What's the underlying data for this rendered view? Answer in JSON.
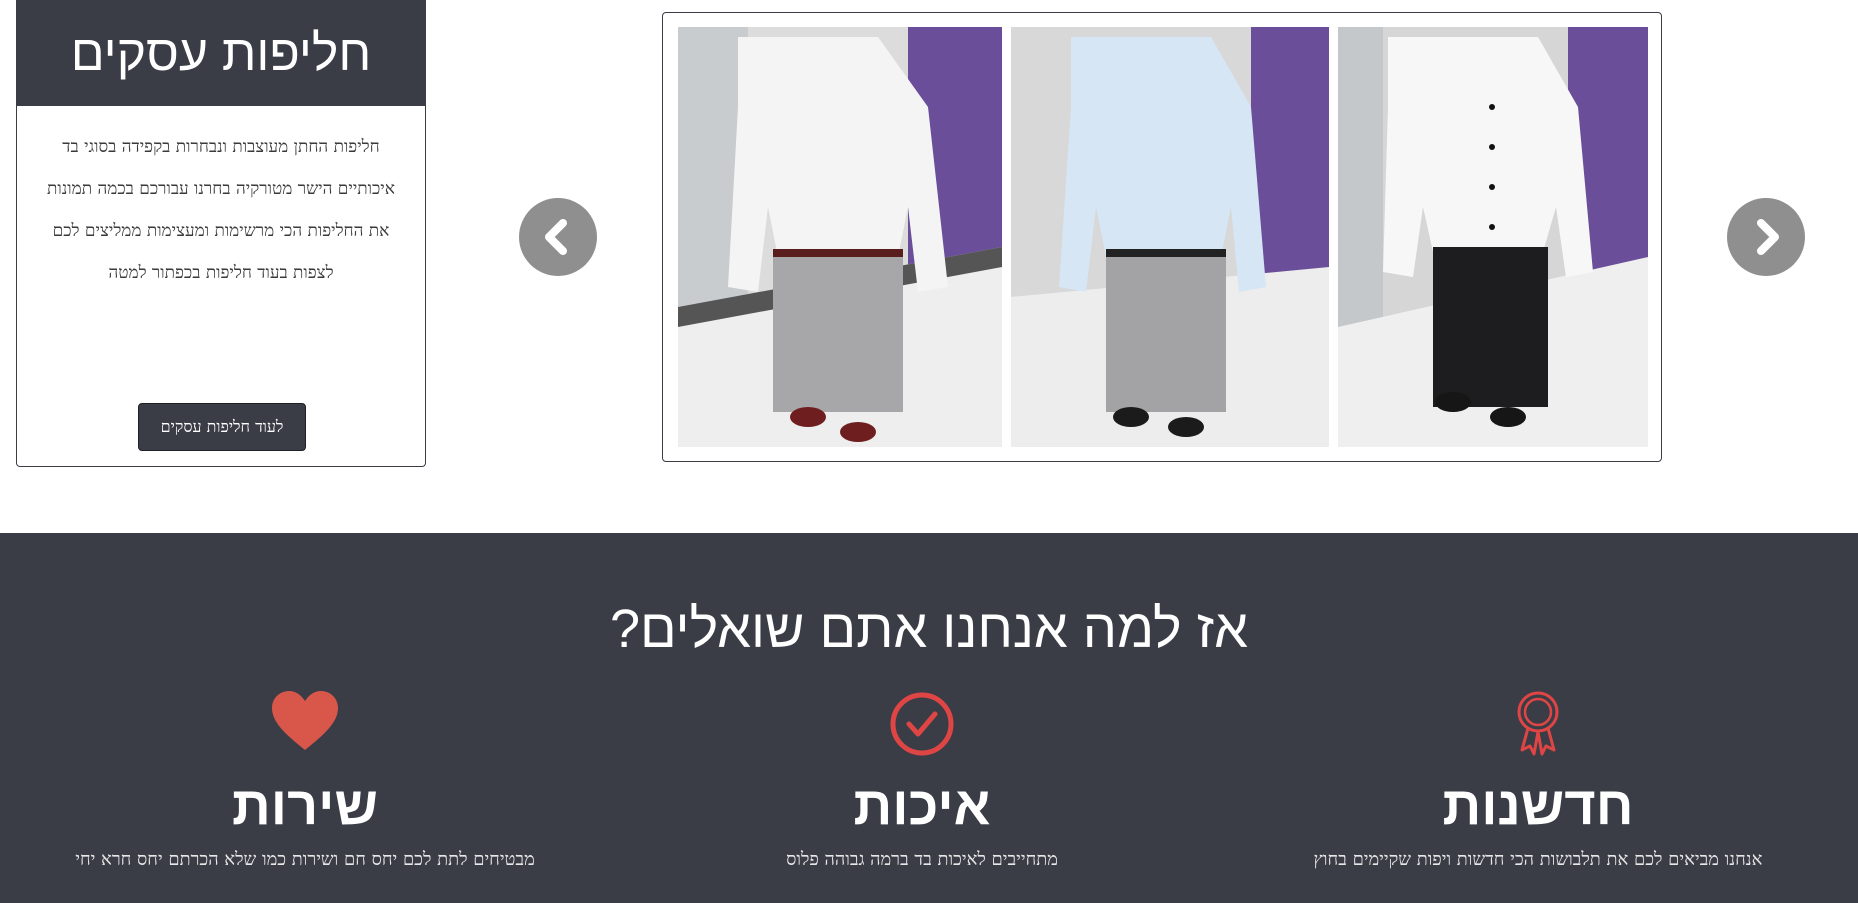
{
  "card": {
    "title": "חליפות עסקים",
    "lines": [
      "חליפות החתן מעוצבות ונבחרות בקפידה בסוגי בד",
      "איכותיים הישר מטורקיה בחרנו עבורכם בכמה תמונות",
      "את החליפות הכי מרשימות ומעצימות ממליצים לכם",
      "לצפות בעוד חליפות בכפתור למטה"
    ],
    "button_label": "לעוד חליפות עסקים"
  },
  "carousel": {
    "prev_icon": "chevron-left-icon",
    "next_icon": "chevron-right-icon",
    "photos": [
      {
        "shirt": "#f4f4f4",
        "pants": "#a7a7a9",
        "shoes": "#6e1e1e"
      },
      {
        "shirt": "#d6e6f5",
        "pants": "#a3a3a5",
        "shoes": "#1b1b1b"
      },
      {
        "shirt": "#f7f7f7",
        "pants": "#1d1d20",
        "shoes": "#161616"
      }
    ]
  },
  "why": {
    "title": "אז למה אנחנו אתם שואלים?",
    "features": [
      {
        "icon": "heart-icon",
        "title": "שירות",
        "desc": "מבטיחים לתת לכם יחס חם ושירות כמו שלא הכרתם יחס חרא יחי"
      },
      {
        "icon": "check-circle-icon",
        "title": "איכות",
        "desc": "מתחייבים לאיכות בד ברמה גבוהה פלוס"
      },
      {
        "icon": "award-icon",
        "title": "חדשנות",
        "desc": "אנחנו מביאים לכם את תלבושות הכי חדשות ויפות שקיימים בחוץ"
      }
    ]
  },
  "colors": {
    "dark": "#3a3d46",
    "accent": "#e04545",
    "arrow": "#8f8f8f"
  }
}
